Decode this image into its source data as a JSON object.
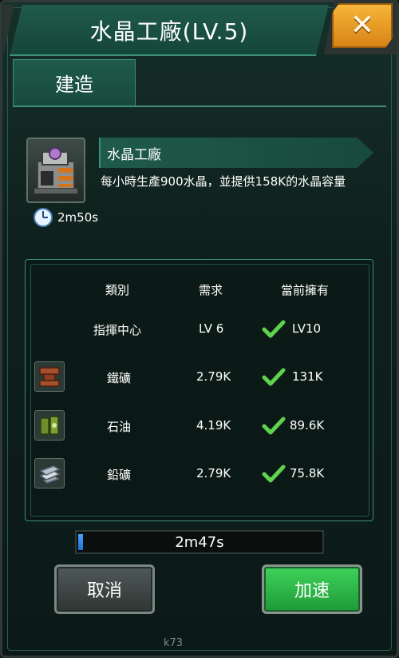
{
  "dialog": {
    "title": "水晶工廠(LV.5)",
    "close_icon": "close-x-icon"
  },
  "tab": {
    "label": "建造"
  },
  "building": {
    "name": "水晶工廠",
    "description": "每小時生產900水晶，並提供158K的水晶容量",
    "build_time": "2m50s"
  },
  "requirements": {
    "headers": [
      "類別",
      "需求",
      "當前擁有"
    ],
    "rows": [
      {
        "category": "指揮中心",
        "required": "LV 6",
        "owned": "LV10",
        "met": true,
        "icon": ""
      },
      {
        "category": "鐵礦",
        "required": "2.79K",
        "owned": "131K",
        "met": true,
        "icon": "iron-ore-icon"
      },
      {
        "category": "石油",
        "required": "4.19K",
        "owned": "89.6K",
        "met": true,
        "icon": "oil-barrel-icon"
      },
      {
        "category": "鉛礦",
        "required": "2.79K",
        "owned": "75.8K",
        "met": true,
        "icon": "lead-ingot-icon"
      }
    ]
  },
  "progress": {
    "remaining": "2m47s",
    "fraction": 0.02
  },
  "buttons": {
    "cancel": "取消",
    "speed_up": "加速"
  },
  "watermark": "k73"
}
